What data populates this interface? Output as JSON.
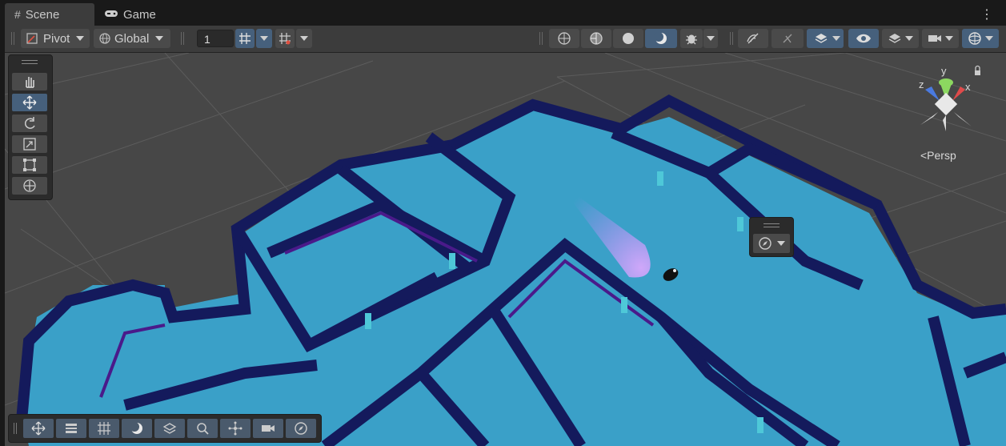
{
  "tabs": [
    {
      "label": "Scene",
      "icon": "hash-icon",
      "active": true
    },
    {
      "label": "Game",
      "icon": "gamepad-icon",
      "active": false
    }
  ],
  "toolbar": {
    "pivot_label": "Pivot",
    "global_label": "Global",
    "grid_value": "1"
  },
  "gizmo": {
    "axis_y": "y",
    "axis_z": "z",
    "axis_x": "x",
    "projection_label": "<Persp"
  },
  "icons": {
    "tools": [
      "hand-icon",
      "move-icon",
      "rotate-icon",
      "scale-icon",
      "rect-icon",
      "transform-icon"
    ],
    "bottom": [
      "move-icon",
      "sliders-icon",
      "grid-snap-icon",
      "shading-icon",
      "layers-icon",
      "search-icon",
      "nodes-icon",
      "camera-icon",
      "compass-icon"
    ]
  },
  "colors": {
    "selected": "#46607c",
    "floor": "#3aa0c8",
    "wall": "#141a5c"
  }
}
